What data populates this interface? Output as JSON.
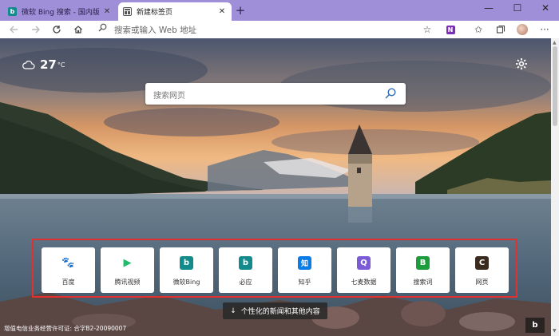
{
  "tabs": [
    {
      "title": "微软 Bing 搜索 - 国内版",
      "icon": "bing-icon"
    },
    {
      "title": "新建标签页",
      "icon": "newtab-page-icon"
    }
  ],
  "tab_close": "✕",
  "new_tab": "+",
  "window_controls": {
    "minimize": "—",
    "maximize": "☐",
    "close": "✕"
  },
  "address": {
    "placeholder": "搜索或输入 Web 地址"
  },
  "weather": {
    "temp": "27",
    "unit": "°C"
  },
  "search": {
    "placeholder": "搜索网页"
  },
  "tiles": [
    {
      "label": "百度",
      "icon": "baidu-paw-icon",
      "color": "#2f6df6",
      "glyph": "🐾"
    },
    {
      "label": "腾讯视频",
      "icon": "tencent-video-icon",
      "color": "#1fbc6b",
      "glyph": "▶"
    },
    {
      "label": "微软Bing",
      "icon": "bing-icon",
      "color": "#138a8c",
      "glyph": "b"
    },
    {
      "label": "必应",
      "icon": "bing-icon",
      "color": "#138a8c",
      "glyph": "b"
    },
    {
      "label": "知乎",
      "icon": "zhihu-icon",
      "color": "#0a7ce8",
      "glyph": "知"
    },
    {
      "label": "七麦数据",
      "icon": "qimai-icon",
      "color": "#7b5cd6",
      "glyph": "Q"
    },
    {
      "label": "搜索词",
      "icon": "search-word-icon",
      "color": "#1c9c3b",
      "glyph": "B"
    },
    {
      "label": "网页",
      "icon": "webpage-icon",
      "color": "#3b2a1e",
      "glyph": "C"
    }
  ],
  "news_button": {
    "label": "个性化的新闻和其他内容",
    "arrow": "↓"
  },
  "license_text": "增值电信业务经营许可证: 合字B2-20090007"
}
